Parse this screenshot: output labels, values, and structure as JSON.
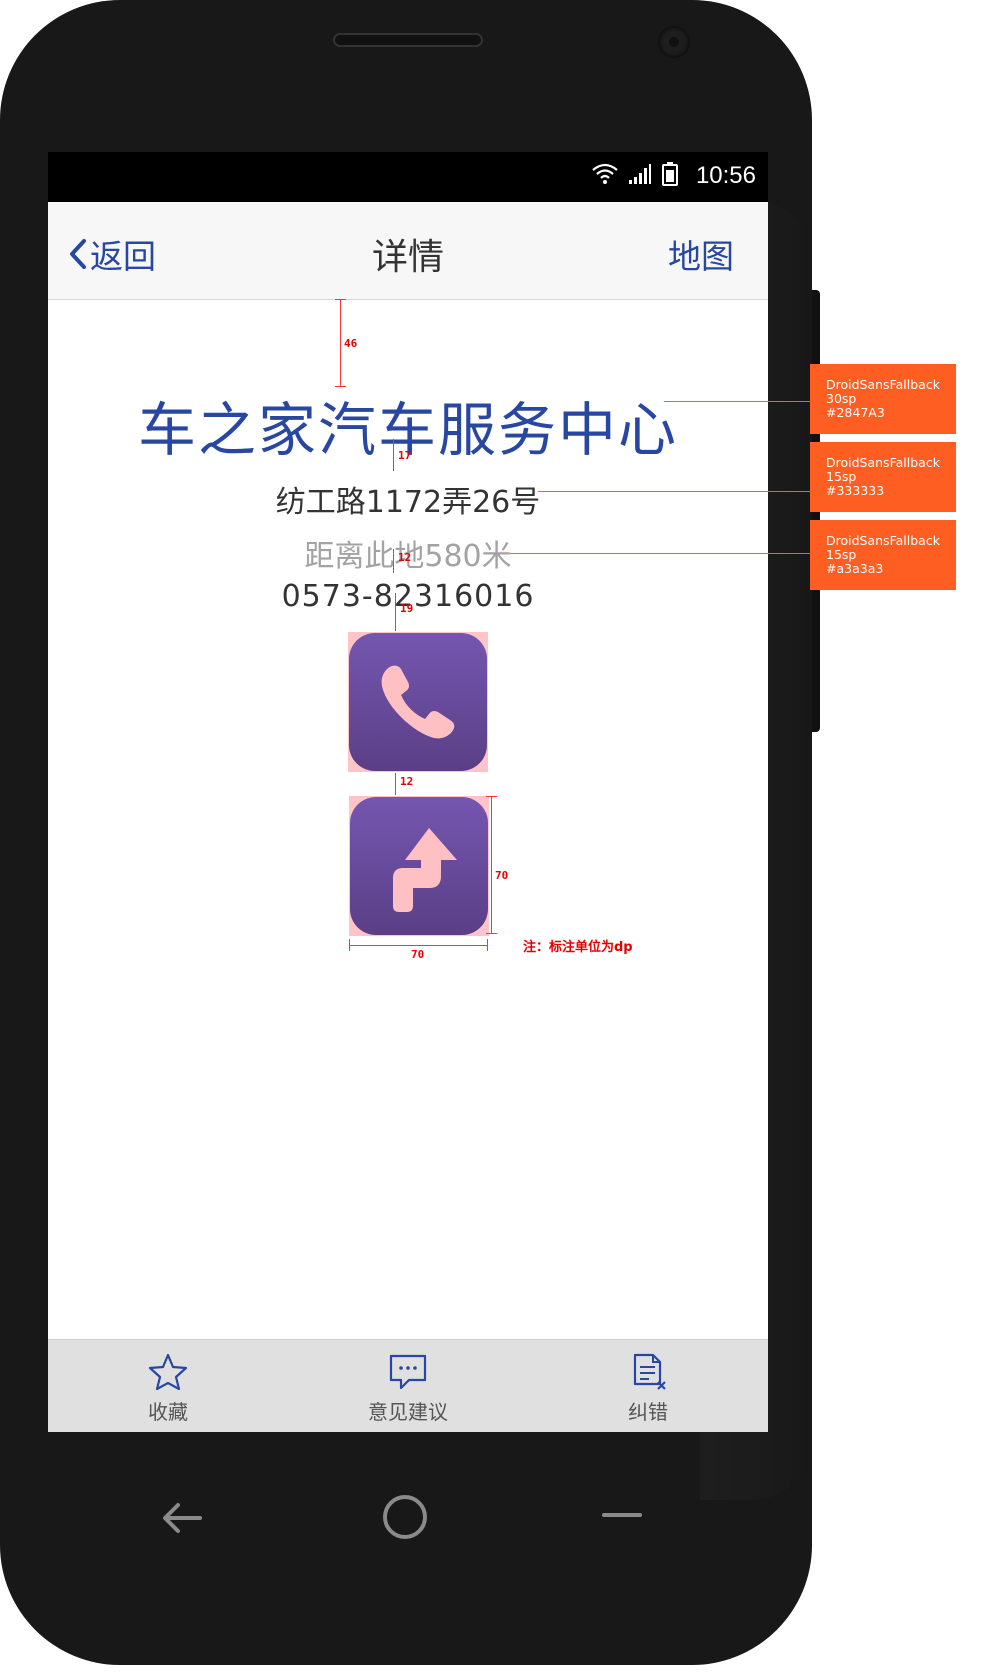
{
  "status_bar": {
    "time": "10:56"
  },
  "nav": {
    "back_label": "返回",
    "title": "详情",
    "map_label": "地图"
  },
  "store": {
    "name": "车之家汽车服务中心",
    "address": "纺工路1172弄26号",
    "distance": "距离此地580米",
    "phone": "0573-82316016"
  },
  "icons": {
    "call": "phone-icon",
    "navigate": "route-turn-icon"
  },
  "measurements": {
    "top_gap": "46",
    "name_gap": "17",
    "distance_gap": "12",
    "phone_gap": "19",
    "icon_gap": "12",
    "icon_height": "70",
    "icon_width": "70"
  },
  "note": "注：标注单位为dp",
  "tabs": [
    {
      "label": "收藏",
      "icon": "star-icon"
    },
    {
      "label": "意见建议",
      "icon": "feedback-chat-icon"
    },
    {
      "label": "纠错",
      "icon": "document-error-icon"
    }
  ],
  "specs": [
    {
      "font": "DroidSansFallback",
      "size": "30sp",
      "color": "#2847A3"
    },
    {
      "font": "DroidSansFallback",
      "size": "15sp",
      "color": "#333333"
    },
    {
      "font": "DroidSansFallback",
      "size": "15sp",
      "color": "#a3a3a3"
    }
  ],
  "colors": {
    "accent": "#2847A3",
    "text": "#333333",
    "muted": "#a3a3a3",
    "annotation": "#ff5e22",
    "icon_tile": "#6b4e9e",
    "icon_glyph": "#ffc0c4"
  }
}
